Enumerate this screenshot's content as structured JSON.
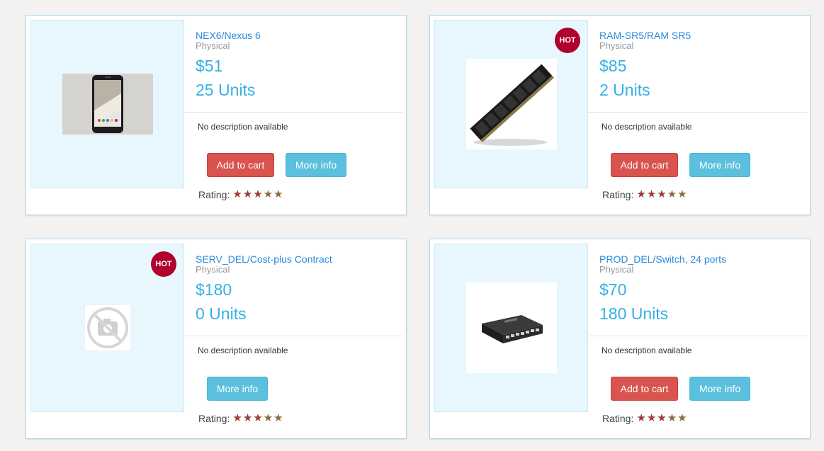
{
  "products": [
    {
      "name": "NEX6/Nexus 6",
      "type": "Physical",
      "price": "$51",
      "units": "25 Units",
      "description": "No description available",
      "add_to_cart_label": "Add to cart",
      "more_info_label": "More info",
      "rating_label": "Rating:",
      "rating_stars": 5,
      "hot": false,
      "image_icon": "phone-image"
    },
    {
      "name": "RAM-SR5/RAM SR5",
      "type": "Physical",
      "price": "$85",
      "units": "2 Units",
      "description": "No description available",
      "add_to_cart_label": "Add to cart",
      "more_info_label": "More info",
      "rating_label": "Rating:",
      "rating_stars": 5,
      "hot": true,
      "hot_label": "HOT",
      "image_icon": "ram-module-image"
    },
    {
      "name": "SERV_DEL/Cost-plus Contract",
      "type": "Physical",
      "price": "$180",
      "units": "0 Units",
      "description": "No description available",
      "more_info_label": "More info",
      "rating_label": "Rating:",
      "rating_stars": 5,
      "hot": true,
      "hot_label": "HOT",
      "image_icon": "no-image-camera-icon"
    },
    {
      "name": "PROD_DEL/Switch, 24 ports",
      "type": "Physical",
      "price": "$70",
      "units": "180 Units",
      "description": "No description available",
      "add_to_cart_label": "Add to cart",
      "more_info_label": "More info",
      "rating_label": "Rating:",
      "rating_stars": 5,
      "hot": false,
      "image_icon": "network-switch-image"
    }
  ],
  "colors": {
    "accent": "#36b0e4",
    "link": "#2a8ad9",
    "danger": "#d9534f",
    "info": "#5bc0de",
    "hot": "#b0002d"
  }
}
